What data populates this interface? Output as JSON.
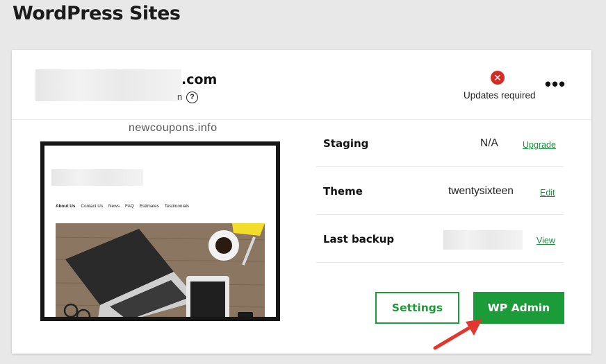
{
  "page": {
    "title": "WordPress Sites"
  },
  "site": {
    "domain_suffix": ".com",
    "subtext_tail": "n",
    "status_icon": "error-x-icon",
    "status_text": "Updates required",
    "menu_glyph": "•••",
    "help_glyph": "?"
  },
  "watermark": "newcoupons.info",
  "preview": {
    "nav": [
      "About Us",
      "Contact Us",
      "News",
      "FAQ",
      "Estimates",
      "Testimonials"
    ]
  },
  "details": {
    "staging": {
      "label": "Staging",
      "value": "N/A",
      "action": "Upgrade"
    },
    "theme": {
      "label": "Theme",
      "value": "twentysixteen",
      "action": "Edit"
    },
    "backup": {
      "label": "Last backup",
      "value": "",
      "action": "View"
    }
  },
  "buttons": {
    "settings": "Settings",
    "wp_admin": "WP Admin"
  },
  "colors": {
    "accent_green": "#1c9b39",
    "error_red": "#d42a22",
    "arrow_red": "#e2362f"
  }
}
